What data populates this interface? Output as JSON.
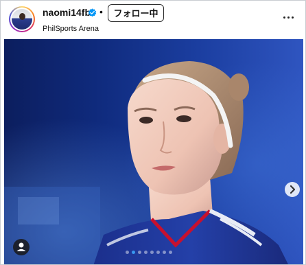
{
  "post": {
    "username": "naomi14fb",
    "separator": "•",
    "follow_label": "フォロー中",
    "location": "PhilSports Arena"
  },
  "carousel": {
    "total_slides": 8,
    "active_index": 1
  },
  "icons": {
    "verified": "verified-badge-icon",
    "more": "more-horizontal-icon",
    "next": "chevron-right-icon",
    "tag": "user-tag-icon"
  },
  "colors": {
    "verified": "#0095f6",
    "active_dot": "#3897f0"
  }
}
